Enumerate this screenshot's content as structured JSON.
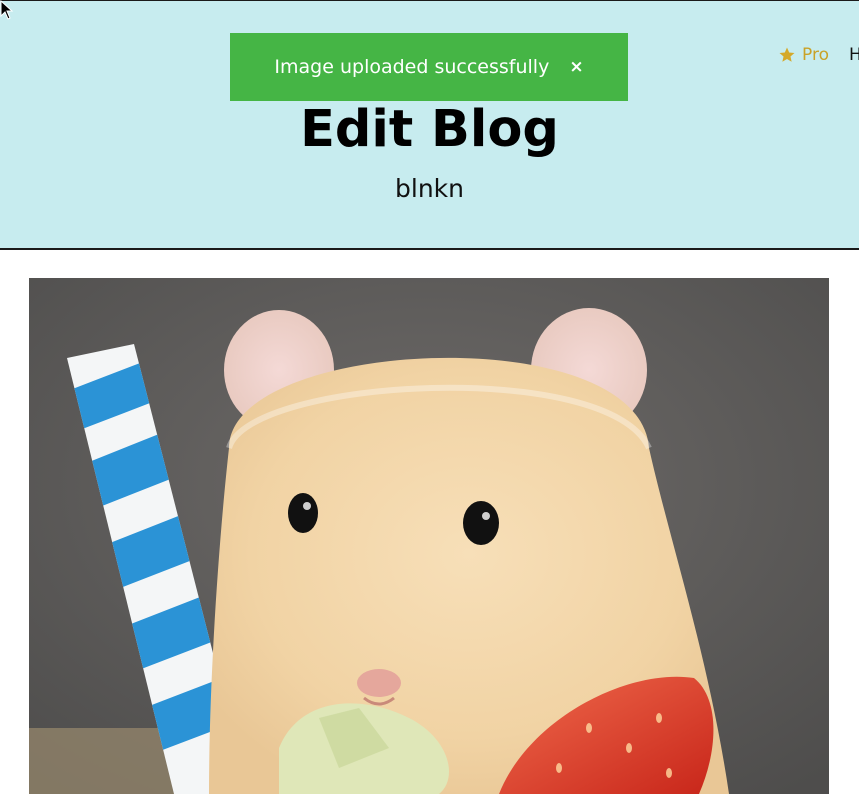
{
  "toast": {
    "message": "Image uploaded successfully",
    "close_symbol": "×"
  },
  "nav": {
    "pro_label": "Pro",
    "pro_icon": "star-icon",
    "next_label": "H"
  },
  "header": {
    "title": "Edit Blog",
    "subtitle": "blnkn"
  },
  "image": {
    "subject": "hamster-photo"
  },
  "colors": {
    "header_bg": "#c7ecef",
    "toast_bg": "#45b545",
    "pro_color": "#c9a227"
  }
}
